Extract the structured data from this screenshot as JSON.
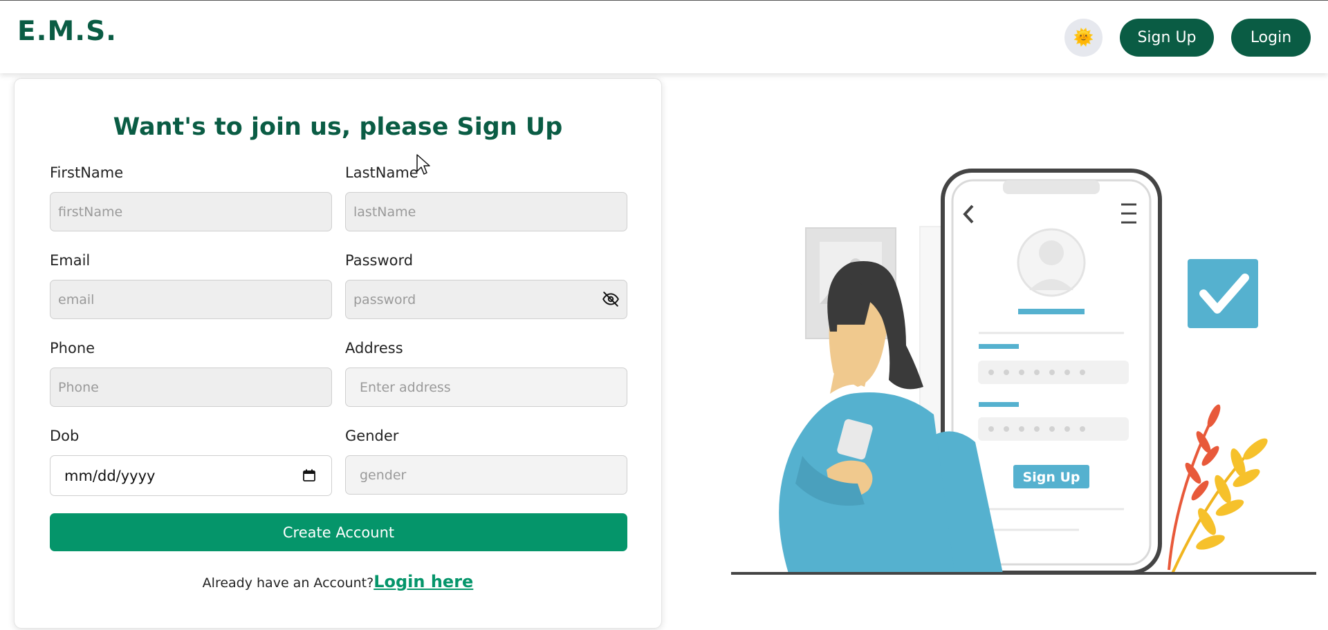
{
  "navbar": {
    "brand": "E.M.S.",
    "theme_icon": "sun-face-emoji",
    "theme_glyph": "🌞",
    "signup_label": "Sign Up",
    "login_label": "Login"
  },
  "form": {
    "title": "Want's to join us, please Sign Up",
    "fields": {
      "first_name": {
        "label": "FirstName",
        "placeholder": "firstName"
      },
      "last_name": {
        "label": "LastName",
        "placeholder": "lastName"
      },
      "email": {
        "label": "Email",
        "placeholder": "email"
      },
      "password": {
        "label": "Password",
        "placeholder": "password"
      },
      "phone": {
        "label": "Phone",
        "placeholder": "Phone"
      },
      "address": {
        "label": "Address",
        "placeholder": "Enter address"
      },
      "dob": {
        "label": "Dob",
        "value": "mm/dd/yyyy"
      },
      "gender": {
        "label": "Gender",
        "placeholder": "gender"
      }
    },
    "submit_label": "Create Account",
    "login_prompt": "Already have an Account?",
    "login_link": "Login here"
  },
  "illustration": {
    "phone_button_label": "Sign Up"
  },
  "colors": {
    "brand": "#0a5c44",
    "primary": "#05956a",
    "input_bg": "#eeeeee",
    "illustration_accent": "#55b1cf"
  }
}
